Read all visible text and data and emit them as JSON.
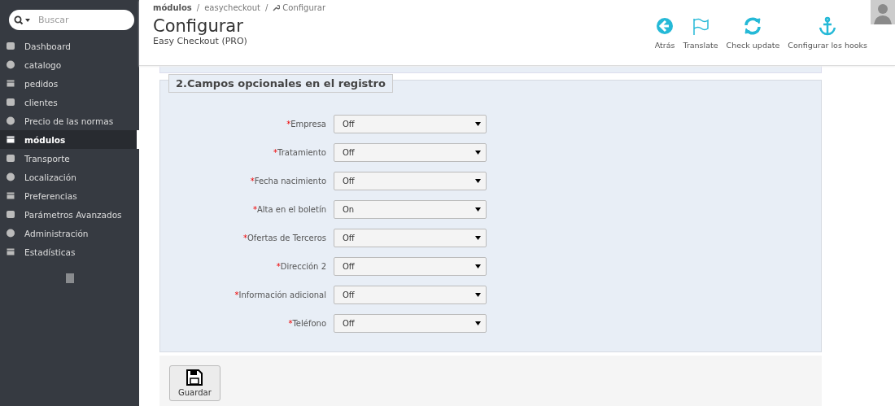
{
  "sidebar": {
    "search": {
      "placeholder": "Buscar"
    },
    "items": [
      {
        "label": "Dashboard",
        "selected": false
      },
      {
        "label": "catalogo",
        "selected": false
      },
      {
        "label": "pedidos",
        "selected": false
      },
      {
        "label": "clientes",
        "selected": false
      },
      {
        "label": "Precio de las normas",
        "selected": false
      },
      {
        "label": "módulos",
        "selected": true
      },
      {
        "label": "Transporte",
        "selected": false
      },
      {
        "label": "Localización",
        "selected": false
      },
      {
        "label": "Preferencias",
        "selected": false
      },
      {
        "label": "Parámetros Avanzados",
        "selected": false
      },
      {
        "label": "Administración",
        "selected": false
      },
      {
        "label": "Estadísticas",
        "selected": false
      }
    ]
  },
  "breadcrumb": [
    "módulos",
    "easycheckout",
    "Configurar"
  ],
  "breadcrumb_separator": "/",
  "page_title": "Configurar",
  "subtitle": "Easy Checkout (PRO)",
  "toolbar": [
    {
      "label": "Atrás"
    },
    {
      "label": "Translate"
    },
    {
      "label": "Check update"
    },
    {
      "label": "Configurar los hooks"
    }
  ],
  "panel": {
    "legend": "2.Campos opcionales en el registro",
    "fields": [
      {
        "mark": "*",
        "label": "Empresa",
        "value": "Off"
      },
      {
        "mark": "*",
        "label": "Tratamiento",
        "value": "Off"
      },
      {
        "mark": "*",
        "label": "Fecha nacimiento",
        "value": "Off"
      },
      {
        "mark": "*",
        "label": "Alta en el boletín",
        "value": "On"
      },
      {
        "mark": "*",
        "label": "Ofertas de Terceros",
        "value": "Off"
      },
      {
        "mark": "*",
        "label": "Dirección 2",
        "value": "Off"
      },
      {
        "mark": "*",
        "label": "Información adicional",
        "value": "Off"
      },
      {
        "mark": "*",
        "label": "Teléfono",
        "value": "Off"
      }
    ]
  },
  "save_button": "Guardar"
}
